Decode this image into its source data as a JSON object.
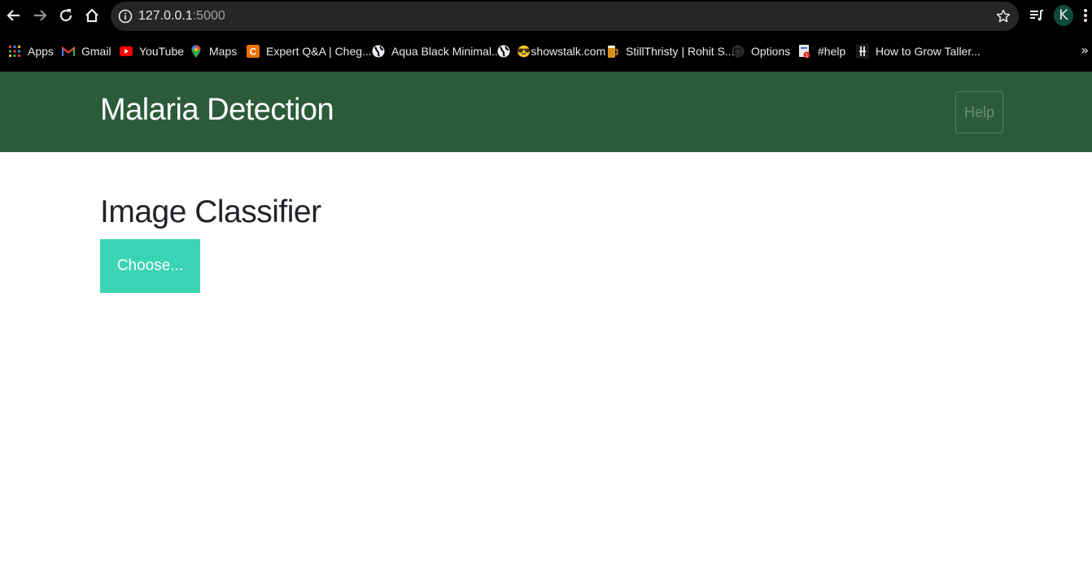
{
  "browser": {
    "url_host": "127.0.0.1",
    "url_port": ":5000",
    "profile_initial": "K",
    "bookmarks": [
      {
        "label": "Apps",
        "icon": "apps-grid-icon"
      },
      {
        "label": "Gmail",
        "icon": "gmail-icon"
      },
      {
        "label": "YouTube",
        "icon": "youtube-icon"
      },
      {
        "label": "Maps",
        "icon": "maps-pin-icon"
      },
      {
        "label": "Expert Q&A | Cheg...",
        "icon": "chegg-icon"
      },
      {
        "label": "Aqua Black Minimal...",
        "icon": "globe-icon"
      },
      {
        "label": "😎showstalk.com",
        "icon": "globe-icon"
      },
      {
        "label": "StillThristy | Rohit S...",
        "icon": "beer-mug-icon"
      },
      {
        "label": "Options",
        "icon": "github-icon"
      },
      {
        "label": "#help",
        "icon": "help-page-icon"
      },
      {
        "label": "How to Grow Taller...",
        "icon": "hashnode-icon"
      }
    ],
    "overflow_label": "»"
  },
  "navbar": {
    "brand": "Malaria Detection",
    "help_label": "Help"
  },
  "main": {
    "heading": "Image Classifier",
    "choose_label": "Choose..."
  },
  "colors": {
    "navbar_bg": "#2c5b3a",
    "choose_bg": "#3ad4b4",
    "chrome_bg": "#000000"
  }
}
